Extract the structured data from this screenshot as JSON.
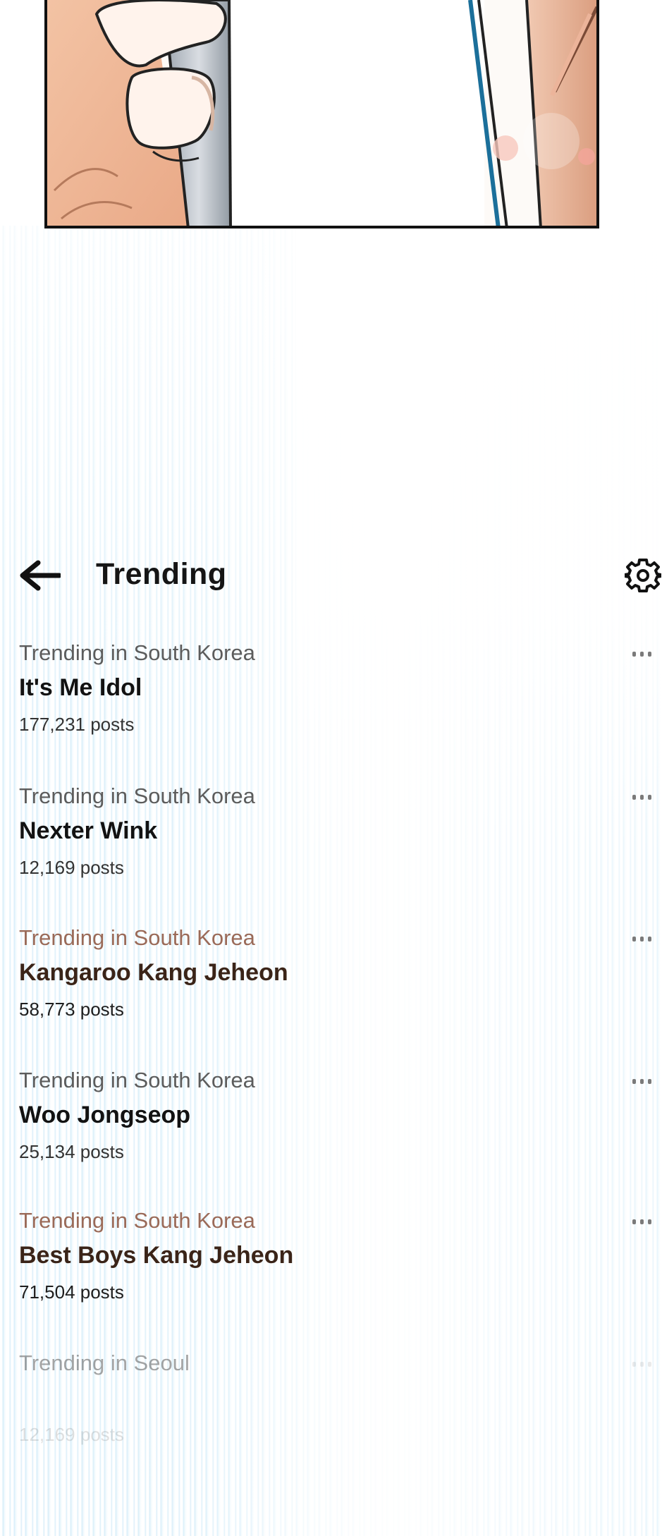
{
  "header": {
    "back_icon": "arrow-left-icon",
    "title": "Trending",
    "settings_icon": "gear-icon"
  },
  "trends": [
    {
      "context": "Trending in South Korea",
      "name": "It's Me Idol",
      "count": "177,231 posts",
      "more_icon": "more-horizontal-icon"
    },
    {
      "context": "Trending in South Korea",
      "name": "Nexter Wink",
      "count": "12,169 posts",
      "more_icon": "more-horizontal-icon"
    },
    {
      "context": "Trending in South Korea",
      "name": "Kangaroo Kang Jeheon",
      "count": "58,773 posts",
      "more_icon": "more-horizontal-icon"
    },
    {
      "context": "Trending in South Korea",
      "name": "Woo Jongseop",
      "count": "25,134 posts",
      "more_icon": "more-horizontal-icon"
    },
    {
      "context": "Trending in South Korea",
      "name": "Best Boys Kang Jeheon",
      "count": "71,504 posts",
      "more_icon": "more-horizontal-icon"
    },
    {
      "context": "Trending in Seoul",
      "name": "",
      "count": "12,169 posts",
      "more_icon": "more-horizontal-icon"
    }
  ],
  "colors": {
    "warm_context": "#9a6a58",
    "warm_name": "#3a2418",
    "speedline_blue": "#96d2f0"
  }
}
